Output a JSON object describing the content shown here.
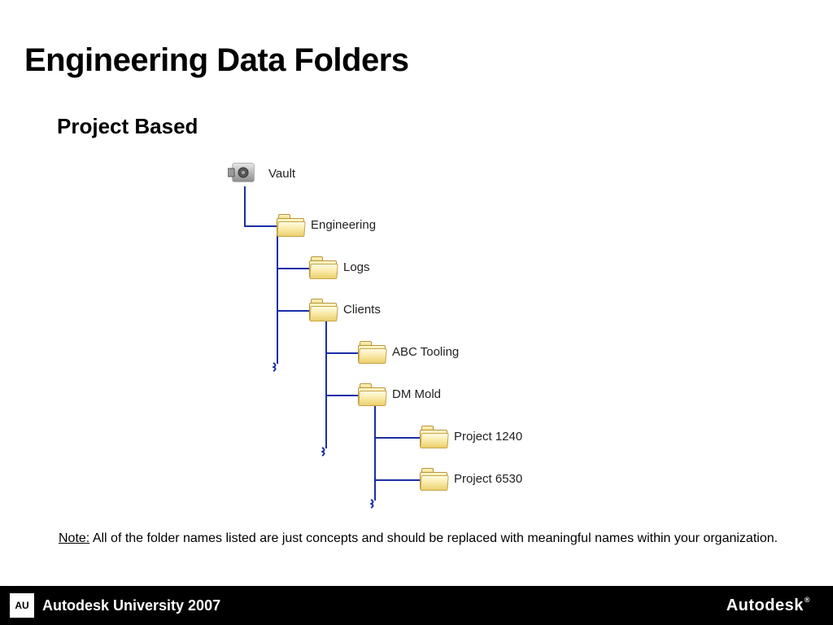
{
  "title": "Engineering Data Folders",
  "subtitle": "Project Based",
  "tree": {
    "vault": "Vault",
    "engineering": "Engineering",
    "logs": "Logs",
    "clients": "Clients",
    "abc_tooling": "ABC Tooling",
    "dm_mold": "DM Mold",
    "project_1240": "Project 1240",
    "project_6530": "Project 6530"
  },
  "note": {
    "label": "Note:",
    "text": "  All of the folder names listed are just concepts and should be replaced with meaningful names within your organization."
  },
  "footer": {
    "au_badge": "AU",
    "left": "Autodesk University 2007",
    "right": "Autodesk"
  }
}
